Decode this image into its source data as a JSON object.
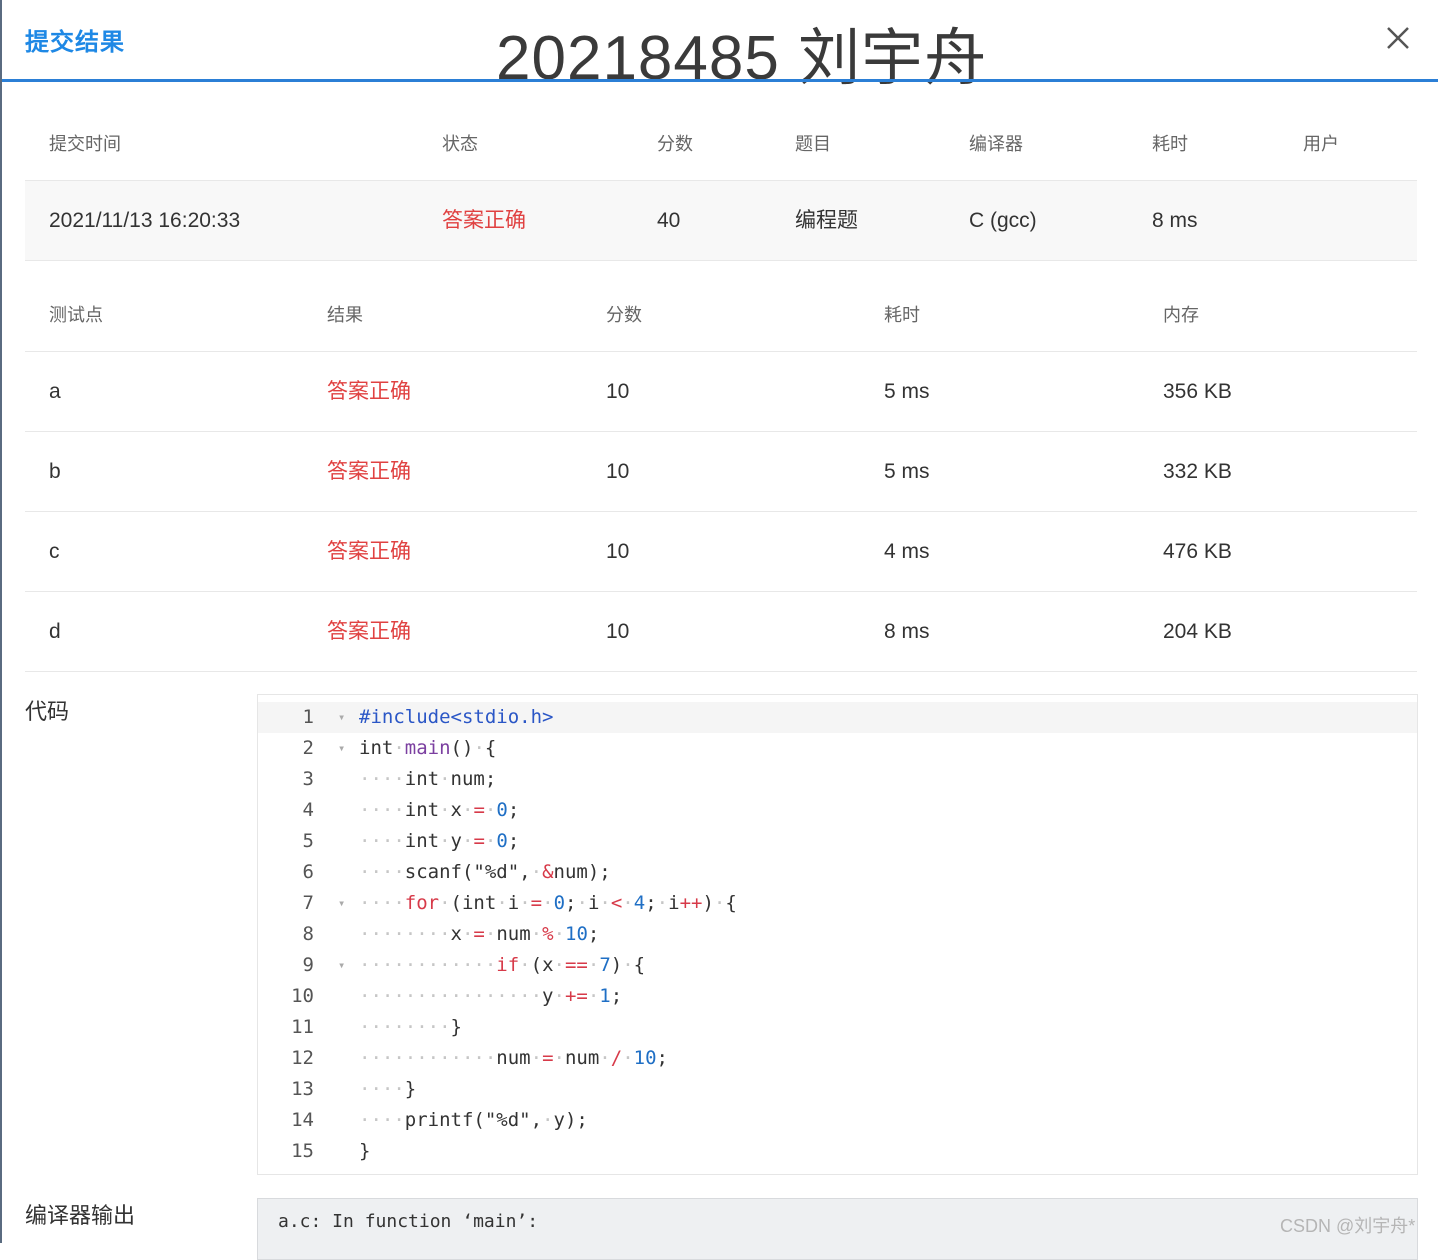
{
  "dialog": {
    "title": "提交结果",
    "overlay_name": "20218485 刘宇舟",
    "close_icon": "close-icon"
  },
  "summary": {
    "headers": [
      "提交时间",
      "状态",
      "分数",
      "题目",
      "编译器",
      "耗时",
      "用户"
    ],
    "row": {
      "time": "2021/11/13 16:20:33",
      "status": "答案正确",
      "score": "40",
      "problem": "编程题",
      "compiler": "C (gcc)",
      "elapsed": "8 ms",
      "user": ""
    }
  },
  "tests": {
    "headers": [
      "测试点",
      "结果",
      "分数",
      "耗时",
      "内存"
    ],
    "rows": [
      {
        "point": "a",
        "result": "答案正确",
        "score": "10",
        "time": "5 ms",
        "memory": "356 KB"
      },
      {
        "point": "b",
        "result": "答案正确",
        "score": "10",
        "time": "5 ms",
        "memory": "332 KB"
      },
      {
        "point": "c",
        "result": "答案正确",
        "score": "10",
        "time": "4 ms",
        "memory": "476 KB"
      },
      {
        "point": "d",
        "result": "答案正确",
        "score": "10",
        "time": "8 ms",
        "memory": "204 KB"
      }
    ]
  },
  "code": {
    "label": "代码",
    "lines": [
      "#include<stdio.h>",
      "int main() {",
      "    int num;",
      "    int x = 0;",
      "    int y = 0;",
      "    scanf(\"%d\", &num);",
      "    for (int i = 0; i < 4; i++) {",
      "        x = num % 10;",
      "            if (x == 7) {",
      "                y += 1;",
      "        }",
      "            num = num / 10;",
      "    }",
      "    printf(\"%d\", y);",
      "}"
    ]
  },
  "compiler_output": {
    "label": "编译器输出",
    "text": "a.c: In function ‘main’:"
  },
  "watermark": "CSDN @刘宇舟*",
  "colors": {
    "accent": "#1e88e5",
    "status_ok": "#e04141"
  }
}
